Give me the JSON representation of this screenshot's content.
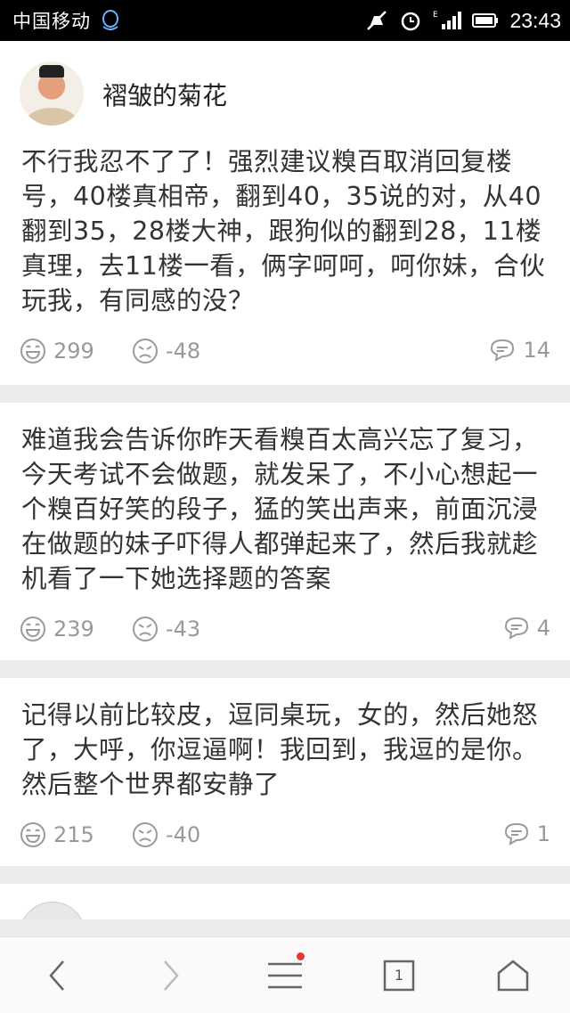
{
  "status_bar": {
    "carrier": "中国移动",
    "network": "E",
    "time": "23:43"
  },
  "posts": [
    {
      "user": "褶皱的菊花",
      "text": "不行我忍不了了！强烈建议糗百取消回复楼号，40楼真相帝，翻到40，35说的对，从40翻到35，28楼大神，跟狗似的翻到28，11楼真理，去11楼一看，俩字呵呵，呵你妹，合伙玩我，有同感的没？",
      "likes": "299",
      "dislikes": "-48",
      "comments": "14"
    },
    {
      "user": "",
      "text": "难道我会告诉你昨天看糗百太高兴忘了复习，今天考试不会做题，就发呆了，不小心想起一个糗百好笑的段子，猛的笑出声来，前面沉浸在做题的妹子吓得人都弹起来了，然后我就趁机看了一下她选择题的答案",
      "likes": "239",
      "dislikes": "-43",
      "comments": "4"
    },
    {
      "user": "",
      "text": "记得以前比较皮，逗同桌玩，女的，然后她怒了，大呼，你逗逼啊！我回到，我逗的是你。然后整个世界都安静了",
      "likes": "215",
      "dislikes": "-40",
      "comments": "1"
    }
  ],
  "bottom_nav": {
    "tab_count": "1",
    "items": [
      "back-icon",
      "forward-icon",
      "menu-icon",
      "tabs-icon",
      "home-icon"
    ]
  },
  "colors": {
    "icon_gray": "#9a9a9a",
    "separator": "#ececec",
    "notification_dot": "#e33333"
  }
}
